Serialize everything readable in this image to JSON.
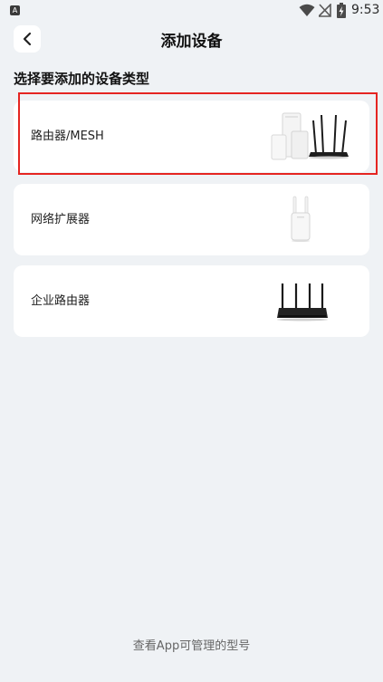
{
  "status_bar": {
    "app_icon_letter": "A",
    "time": "9:53"
  },
  "header": {
    "title": "添加设备"
  },
  "section": {
    "title": "选择要添加的设备类型"
  },
  "devices": [
    {
      "label": "路由器/MESH",
      "image": "router-mesh-image",
      "highlighted": true
    },
    {
      "label": "网络扩展器",
      "image": "range-extender-image",
      "highlighted": false
    },
    {
      "label": "企业路由器",
      "image": "enterprise-router-image",
      "highlighted": false
    }
  ],
  "colors": {
    "background": "#eff2f5",
    "card": "#ffffff",
    "highlight": "#e52521"
  },
  "footer": {
    "link_text": "查看App可管理的型号"
  }
}
